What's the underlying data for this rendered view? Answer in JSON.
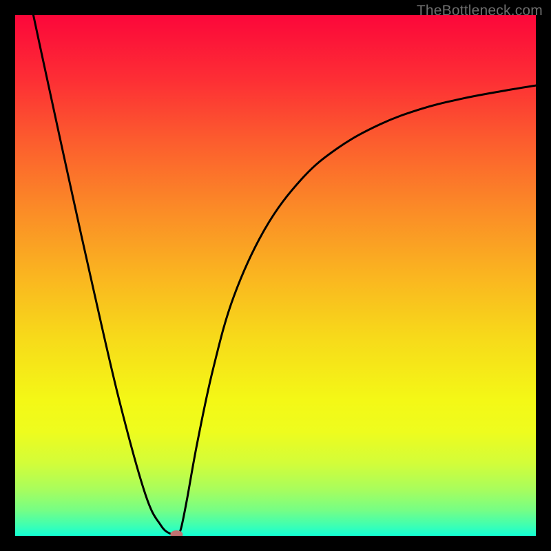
{
  "watermark": "TheBottleneck.com",
  "chart_data": {
    "type": "line",
    "title": "",
    "xlabel": "",
    "ylabel": "",
    "xlim": [
      0,
      100
    ],
    "ylim": [
      0,
      100
    ],
    "grid": false,
    "legend": false,
    "series": [
      {
        "name": "curve",
        "x": [
          3.5,
          5,
          10,
          15,
          20,
          25,
          28,
          30,
          31,
          31.5,
          32,
          33,
          35,
          38,
          42,
          48,
          55,
          62,
          70,
          78,
          86,
          94,
          100
        ],
        "y": [
          100,
          93,
          70,
          47.5,
          26,
          8,
          2,
          0.3,
          0,
          0.5,
          2,
          7,
          18,
          32,
          46,
          59,
          68.5,
          74.5,
          79,
          82,
          84,
          85.5,
          86.5
        ]
      }
    ],
    "min_point": {
      "x": 31,
      "y": 0
    },
    "gradient_stops": [
      {
        "offset": 0.0,
        "color": "#fc073a"
      },
      {
        "offset": 0.12,
        "color": "#fd2d35"
      },
      {
        "offset": 0.24,
        "color": "#fc5c2e"
      },
      {
        "offset": 0.37,
        "color": "#fb8a27"
      },
      {
        "offset": 0.5,
        "color": "#fab520"
      },
      {
        "offset": 0.62,
        "color": "#f7da1a"
      },
      {
        "offset": 0.74,
        "color": "#f4f816"
      },
      {
        "offset": 0.8,
        "color": "#eefc1e"
      },
      {
        "offset": 0.86,
        "color": "#d3fd39"
      },
      {
        "offset": 0.91,
        "color": "#a9fd5c"
      },
      {
        "offset": 0.95,
        "color": "#77fe84"
      },
      {
        "offset": 0.98,
        "color": "#3effb2"
      },
      {
        "offset": 1.0,
        "color": "#13ffd4"
      }
    ],
    "marker": {
      "fill": "#c17171",
      "rx": 9,
      "ry": 6
    }
  }
}
